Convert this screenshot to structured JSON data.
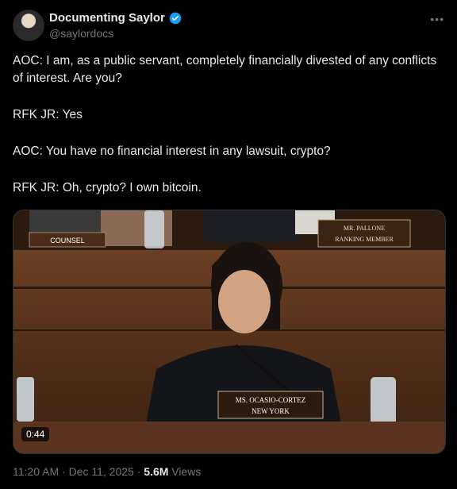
{
  "author": {
    "display_name": "Documenting Saylor",
    "handle": "@saylordocs"
  },
  "tweet": {
    "lines": [
      "AOC: I am, as a public servant, completely financially divested of any conflicts of interest. Are you?",
      "RFK JR: Yes",
      "AOC: You have no financial interest in any lawsuit, crypto?",
      "RFK JR: Oh, crypto? I own bitcoin."
    ]
  },
  "media": {
    "duration": "0:44",
    "placards": {
      "counsel": "COUNSEL",
      "pallone_line1": "MR. PALLONE",
      "pallone_line2": "RANKING MEMBER",
      "speaker_line1": "MS. OCASIO-CORTEZ",
      "speaker_line2": "NEW YORK"
    }
  },
  "meta": {
    "time": "11:20 AM",
    "date": "Dec 11, 2025",
    "views_count": "5.6M",
    "views_label": "Views"
  },
  "colors": {
    "background": "#000000",
    "text": "#e7e9ea",
    "muted": "#71767b",
    "verified": "#1d9bf0"
  }
}
